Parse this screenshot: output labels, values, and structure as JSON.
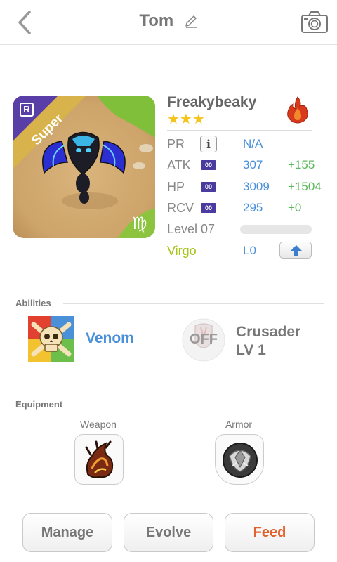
{
  "header": {
    "title": "Tom",
    "icons": {
      "back": "chevron-left-icon",
      "edit": "pencil-icon",
      "camera": "camera-icon"
    }
  },
  "monster": {
    "name": "Freakybeaky",
    "stars": "★★★",
    "rarity_badge": "R",
    "rank_ribbon": "Super",
    "element": "fire",
    "sign_glyph": "♍",
    "stats": {
      "pr": {
        "label": "PR",
        "value": "N/A"
      },
      "atk": {
        "label": "ATK",
        "badge": "00",
        "value": "307",
        "bonus": "+155"
      },
      "hp": {
        "label": "HP",
        "badge": "00",
        "value": "3009",
        "bonus": "+1504"
      },
      "rcv": {
        "label": "RCV",
        "badge": "00",
        "value": "295",
        "bonus": "+0"
      }
    },
    "level": {
      "label": "Level 07",
      "progress": 0.0
    },
    "sign": {
      "label": "Virgo",
      "value": "L0"
    }
  },
  "abilities": {
    "section_label": "Abilities",
    "items": [
      {
        "name": "Venom",
        "icon": "venom-skull-icon"
      },
      {
        "name_line1": "Crusader",
        "name_line2": "LV 1",
        "status": "OFF",
        "icon": "crusader-icon"
      }
    ]
  },
  "equipment": {
    "section_label": "Equipment",
    "weapon_label": "Weapon",
    "armor_label": "Armor"
  },
  "actions": {
    "manage": "Manage",
    "evolve": "Evolve",
    "feed": "Feed"
  },
  "colors": {
    "accent_blue": "#4a90d9",
    "bonus_green": "#5cb85c",
    "virgo_green": "#a6c51b",
    "feed_orange": "#e3612d",
    "star_gold": "#f5c31a",
    "badge_purple": "#4a3b9f"
  }
}
